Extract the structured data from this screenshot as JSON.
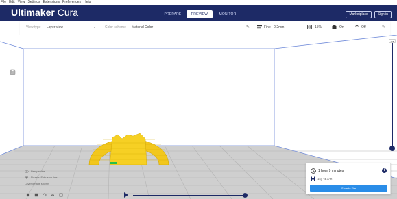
{
  "menu": [
    "File",
    "Edit",
    "View",
    "Settings",
    "Extensions",
    "Preferences",
    "Help"
  ],
  "brand": {
    "bold": "Ultimaker",
    "light": "Cura"
  },
  "stages": {
    "prepare": "PREPARE",
    "preview": "PREVIEW",
    "monitor": "MONITOR"
  },
  "top_right": {
    "marketplace": "Marketplace",
    "signin": "Sign in"
  },
  "header": {
    "view_type_label": "View type",
    "view_type_value": "Layer view",
    "color_scheme_label": "Color scheme",
    "color_scheme_value": "Material Color",
    "profile": "Fine - 0.2mm",
    "infill": "15%",
    "support": "On",
    "adhesion": "Off"
  },
  "layer_slider": {
    "top_value": "165",
    "level": 1.0
  },
  "sim_info": [
    "Perspective",
    "Nozzle: Extrusion line",
    "Layer details shown"
  ],
  "print_panel": {
    "time": "1 hour 9 minutes",
    "material": "14g · 4.77m",
    "save_button": "Save to File"
  },
  "simulation_progress": 1.0,
  "colors": {
    "accent": "#1d2a66",
    "model": "#f2c71d",
    "button": "#2a8de8",
    "buildplate": "#c8c8c8"
  },
  "icons": [
    "chevron-down-icon",
    "pencil-icon",
    "profile-icon",
    "infill-icon",
    "support-icon",
    "adhesion-icon",
    "clock-icon",
    "info-icon",
    "spool-icon",
    "play-icon"
  ]
}
